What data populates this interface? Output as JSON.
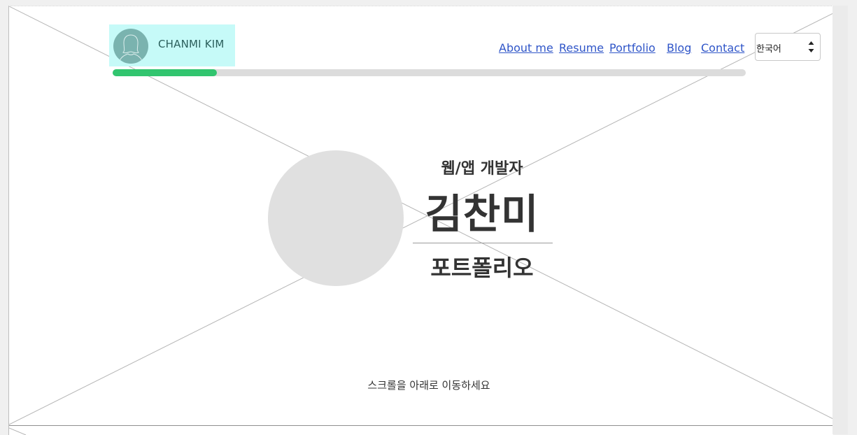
{
  "header": {
    "brand_name": "CHANMI KIM",
    "nav": [
      {
        "label": "About me"
      },
      {
        "label": "Resume"
      },
      {
        "label": "Portfolio"
      },
      {
        "label": "Blog"
      },
      {
        "label": "Contact"
      }
    ],
    "language_select": {
      "value": "한국어"
    },
    "progress_percent": 16.5
  },
  "hero": {
    "role": "웹/앱 개발자",
    "name": "김찬미",
    "subtitle": "포트폴리오"
  },
  "scroll_hint": "스크롤을 아래로 이동하세요",
  "colors": {
    "brand_bg": "#c6faf8",
    "avatar": "#7ab3af",
    "link": "#2f55c8",
    "progress": "#32c56f",
    "progress_track": "#dcdcdc",
    "text": "#333333"
  },
  "icons": {
    "avatar": "person-silhouette-icon",
    "select_arrows": "up-down-arrows-icon"
  }
}
